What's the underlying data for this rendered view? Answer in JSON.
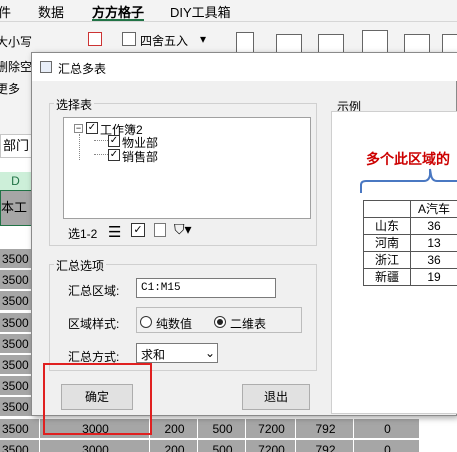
{
  "ribbon": {
    "tabs": [
      "件",
      "数据",
      "方方格子",
      "DIY工具箱"
    ],
    "active_tab": "方方格子",
    "left_items": [
      "大小写",
      "删除空",
      "更多"
    ],
    "round_label": "四舍五入",
    "name_box": "部门"
  },
  "sheet": {
    "column_header": "D",
    "header_cell": "本工",
    "rows": [
      [
        "3500",
        "",
        "",
        "",
        "",
        "",
        ""
      ],
      [
        "3500",
        "",
        "",
        "",
        "",
        "",
        ""
      ],
      [
        "3500",
        "",
        "",
        "",
        "",
        "",
        ""
      ],
      [
        "3500",
        "",
        "",
        "",
        "",
        "",
        ""
      ],
      [
        "3500",
        "",
        "",
        "",
        "",
        "",
        ""
      ],
      [
        "3500",
        "",
        "",
        "",
        "",
        "",
        ""
      ],
      [
        "3500",
        "",
        "",
        "",
        "",
        "",
        ""
      ],
      [
        "3500",
        "",
        "",
        "",
        "",
        "",
        ""
      ],
      [
        "3500",
        "3000",
        "200",
        "500",
        "7200",
        "792",
        "0"
      ],
      [
        "3500",
        "3000",
        "200",
        "500",
        "7200",
        "792",
        "0"
      ]
    ]
  },
  "dialog": {
    "title": "汇总多表",
    "select_group_label": "选择表",
    "tree": {
      "root": "工作簿2",
      "children": [
        "物业部",
        "销售部"
      ]
    },
    "selection_count": "选1-2",
    "options_group_label": "汇总选项",
    "range_label": "汇总区域:",
    "range_value": "C1:M15",
    "style_label": "区域样式:",
    "style_options": [
      "纯数值",
      "二维表"
    ],
    "style_selected": "二维表",
    "method_label": "汇总方式:",
    "method_value": "求和",
    "ok_button": "确定",
    "exit_button": "退出",
    "example_label": "示例",
    "example_caption": "多个此区域的",
    "example_header": "A汽车",
    "example_rows": [
      {
        "name": "山东",
        "value": "36"
      },
      {
        "name": "河南",
        "value": "13"
      },
      {
        "name": "浙江",
        "value": "36"
      },
      {
        "name": "新疆",
        "value": "19"
      }
    ]
  },
  "colors": {
    "accent": "#217346",
    "sheet_fill": "#a6a6a6",
    "highlight_red": "#e02020",
    "caption_red": "#cc0000",
    "brace_blue": "#4a78c2"
  }
}
